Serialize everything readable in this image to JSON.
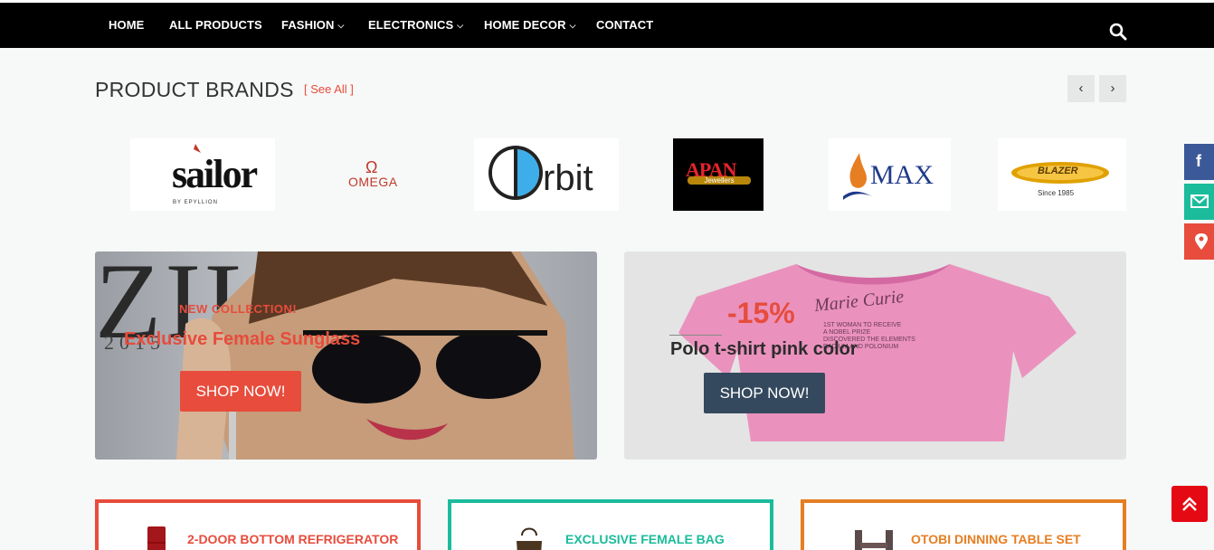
{
  "nav": {
    "items": [
      {
        "label": "HOME"
      },
      {
        "label": "ALL PRODUCTS"
      },
      {
        "label": "FASHION"
      },
      {
        "label": "ELECTRONICS"
      },
      {
        "label": "HOME DECOR"
      },
      {
        "label": "CONTACT"
      }
    ],
    "dropdown_chevron": "⌄"
  },
  "brands": {
    "title": "PRODUCT BRANDS",
    "see_all": "[ See All ]",
    "prev": "‹",
    "next": "›",
    "logos": [
      {
        "name": "sailor",
        "text": "sailor",
        "subtext": "BY EPYLLION"
      },
      {
        "name": "omega",
        "text": "OMEGA",
        "symbol": "Ω"
      },
      {
        "name": "orbit",
        "text": "rbit"
      },
      {
        "name": "apan",
        "text": "APAN",
        "subtext": "Jewellers"
      },
      {
        "name": "max",
        "text": "MAX"
      },
      {
        "name": "blazer",
        "text": "BLAZER",
        "subtext": "Since 1985"
      }
    ]
  },
  "banners": {
    "left": {
      "background_text": "ZILKA",
      "year_text": "2015",
      "kicker": "NEW COLLECTION!",
      "title": "Exclusive Female Sunglass",
      "button": "SHOP NOW!",
      "accent": "#e74c3c"
    },
    "right": {
      "discount": "-15%",
      "title": "Polo t-shirt pink color",
      "shirt_text": "Marie Curie",
      "shirt_lines": [
        "1ST WOMAN TO RECEIVE",
        "A NOBEL PRIZE",
        "DISCOVERED THE ELEMENTS",
        "RADIUM AND POLONIUM"
      ],
      "button": "SHOP NOW!",
      "button_color": "#34495e"
    }
  },
  "cards": [
    {
      "title": "2-DOOR BOTTOM REFRIGERATOR",
      "color": "#e74c3c"
    },
    {
      "title": "EXCLUSIVE FEMALE BAG",
      "color": "#1abc9c"
    },
    {
      "title": "OTOBI DINNING TABLE SET",
      "color": "#e67e22"
    }
  ],
  "social": {
    "facebook": "f",
    "colors": {
      "facebook": "#3b5998",
      "email": "#1abc9c",
      "location": "#e74c3c"
    }
  },
  "icons": [
    "search-icon",
    "facebook-icon",
    "email-icon",
    "location-icon",
    "back-to-top-icon",
    "chevron-left-icon",
    "chevron-right-icon"
  ]
}
